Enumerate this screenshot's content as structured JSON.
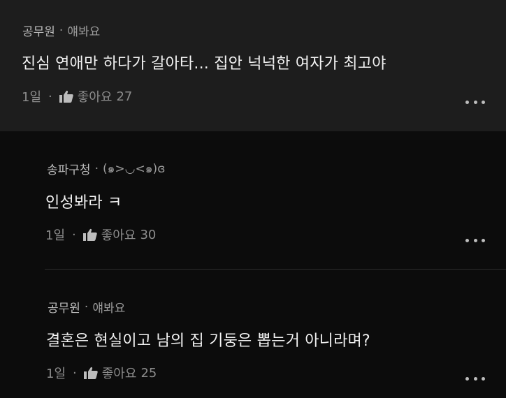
{
  "comments": [
    {
      "nickname": "공무원",
      "role": "얘봐요",
      "text": "진심 연애만 하다가 갈아타... 집안 넉넉한 여자가 최고야",
      "time": "1일",
      "like_label": "좋아요",
      "like_count": "27"
    },
    {
      "nickname": "송파구청",
      "role": "(๑>◡<๑)ɞ",
      "text": "인성봐라 ㅋ",
      "time": "1일",
      "like_label": "좋아요",
      "like_count": "30"
    },
    {
      "nickname": "공무원",
      "role": "얘봐요",
      "text": "결혼은 현실이고 남의 집 기둥은 뽑는거 아니라며?",
      "time": "1일",
      "like_label": "좋아요",
      "like_count": "25"
    }
  ],
  "icons": {
    "like": "thumbs-up-icon",
    "more": "more-dots-icon"
  },
  "colors": {
    "background": "#0c0c0c",
    "top_comment_background": "#1d1d1d",
    "text": "#f2f2f2",
    "meta": "#9b9b9b"
  }
}
